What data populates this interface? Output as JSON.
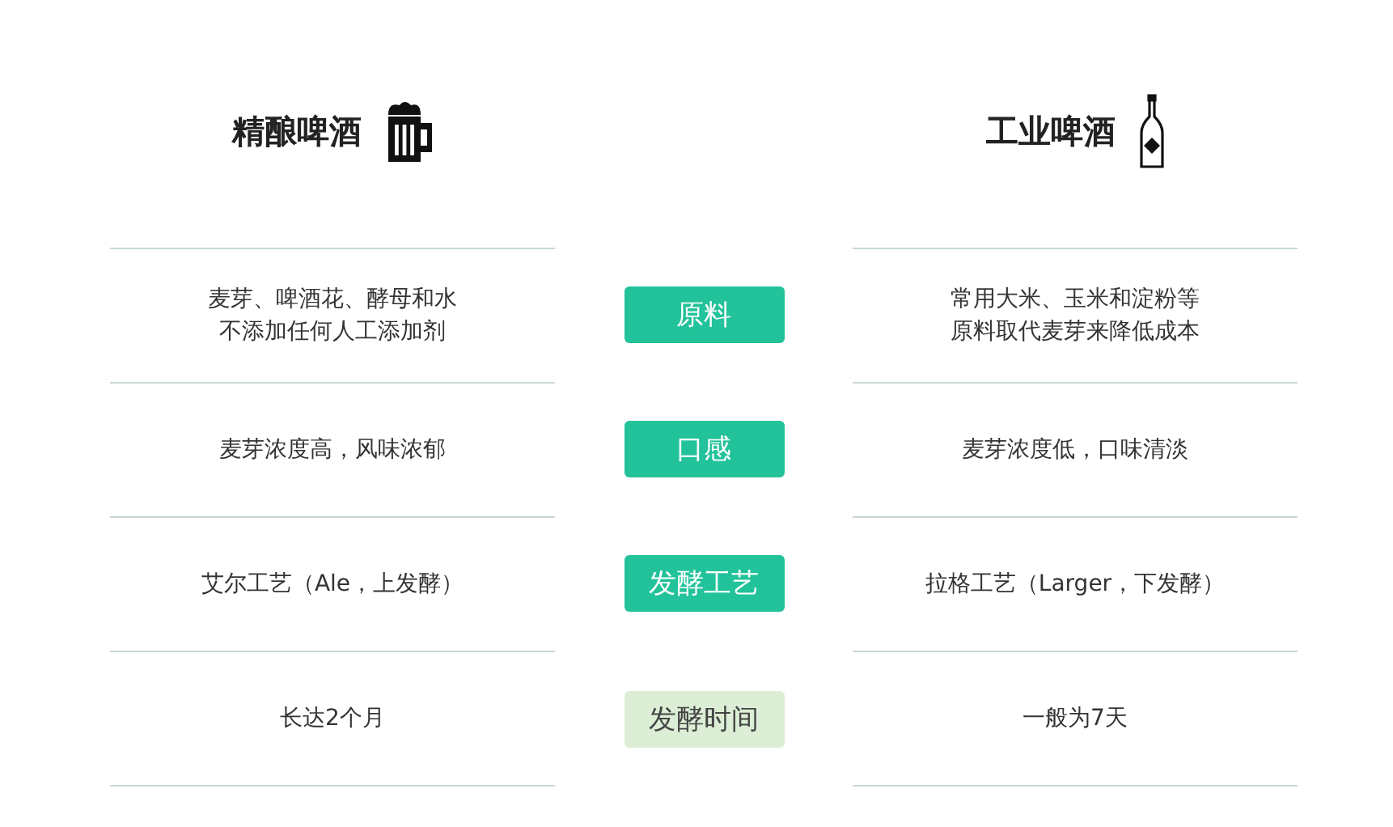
{
  "headers": [
    {
      "title": "精酿啤酒"
    },
    {
      "title": "工业啤酒"
    }
  ],
  "rows": [
    {
      "left": [
        "麦芽、啤酒花、酵母和水",
        "不添加任何人工添加剂"
      ],
      "label": "原料",
      "kind": "filled",
      "right": [
        "常用大米、玉米和淀粉等",
        "原料取代麦芽来降低成本"
      ]
    },
    {
      "left": [
        "麦芽浓度高，风味浓郁"
      ],
      "label": "口感",
      "kind": "filled",
      "right": [
        "麦芽浓度低，口味清淡"
      ]
    },
    {
      "left": [
        "艾尔工艺（Ale，上发酵）"
      ],
      "label": "发酵工艺",
      "kind": "filled",
      "right": [
        "拉格工艺（Larger，下发酵）"
      ]
    },
    {
      "left": [
        "长达2个月"
      ],
      "label": "发酵时间",
      "kind": "pale",
      "right": [
        "一般为7天"
      ]
    }
  ]
}
